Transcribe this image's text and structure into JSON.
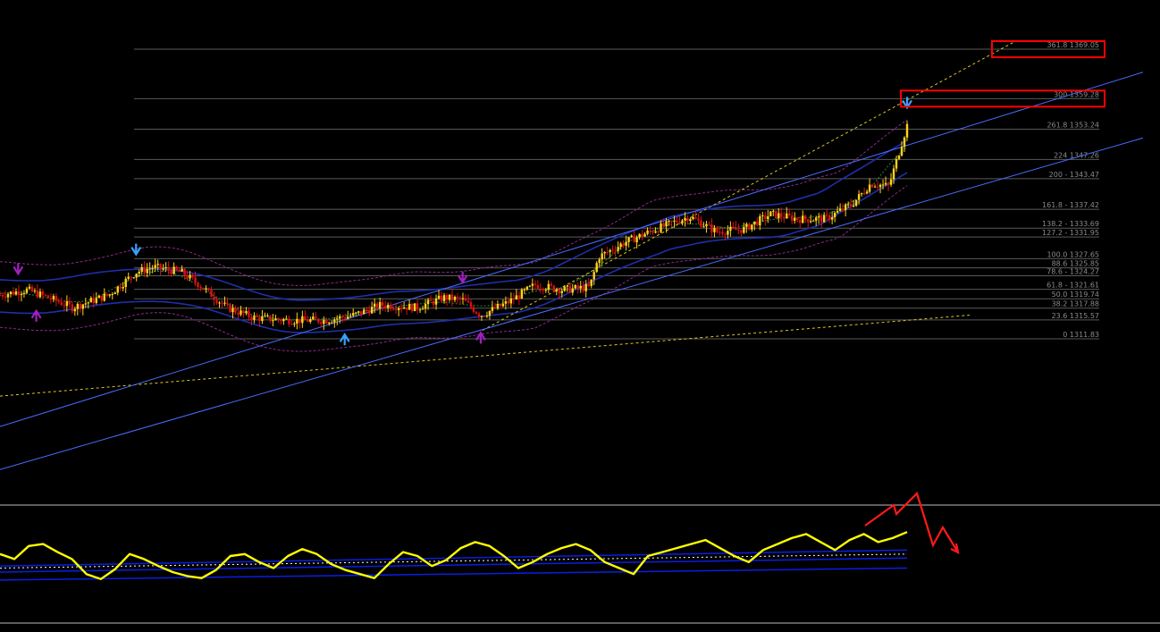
{
  "colors": {
    "background": "#000000",
    "fib_line": "#5a5a5a",
    "fib_text": "#8a8a8a",
    "channel_line": "#4a6cff",
    "candle_up": "#ffd21a",
    "candle_down": "#e01010",
    "band_outer": "#8a2a8a",
    "band_mid": "#1e2fa8",
    "band_dash": "#2e8a2e",
    "ma_dash": "#d8c820",
    "oscillator": "#ffff00",
    "osc_band": "#0a1ee0",
    "highlight_box": "#ff0000",
    "arrow_blue": "#3aa0ff",
    "arrow_purple": "#a020c0",
    "projection": "#ff1a1a"
  },
  "chart_data": {
    "type": "candlestick",
    "title": "",
    "xlabel": "",
    "ylabel": "",
    "ylim": [
      1290.0,
      1372.0
    ],
    "grid": false,
    "fibonacci_levels": [
      {
        "ratio": "361.8",
        "price": "1369.05",
        "highlighted": true
      },
      {
        "ratio": "300",
        "price": "1359.28",
        "highlighted": true
      },
      {
        "ratio": "261.8",
        "price": "1353.24",
        "highlighted": false
      },
      {
        "ratio": "224",
        "price": "1347.26",
        "highlighted": false
      },
      {
        "ratio": "200 -",
        "price": "1343.47",
        "highlighted": false
      },
      {
        "ratio": "161.8 -",
        "price": "1337.42",
        "highlighted": false
      },
      {
        "ratio": "138.2 -",
        "price": "1333.69",
        "highlighted": false
      },
      {
        "ratio": "127.2 -",
        "price": "1331.95",
        "highlighted": false
      },
      {
        "ratio": "100.0",
        "price": "1327.65",
        "highlighted": false
      },
      {
        "ratio": "88.6",
        "price": "1325.85",
        "highlighted": false
      },
      {
        "ratio": "78.6 -",
        "price": "1324.27",
        "highlighted": false
      },
      {
        "ratio": "61.8 -",
        "price": "1321.61",
        "highlighted": false
      },
      {
        "ratio": "50.0",
        "price": "1319.74",
        "highlighted": false
      },
      {
        "ratio": "38.2",
        "price": "1317.88",
        "highlighted": false
      },
      {
        "ratio": "23.6",
        "price": "1315.57",
        "highlighted": false
      },
      {
        "ratio": "0",
        "price": "1311.83",
        "highlighted": false
      }
    ],
    "price_path": [
      [
        0,
        1320.5
      ],
      [
        0.03,
        1321.5
      ],
      [
        0.06,
        1319.5
      ],
      [
        0.08,
        1318.0
      ],
      [
        0.12,
        1320.5
      ],
      [
        0.15,
        1325.0
      ],
      [
        0.17,
        1326.0
      ],
      [
        0.2,
        1325.0
      ],
      [
        0.22,
        1322.5
      ],
      [
        0.25,
        1318.0
      ],
      [
        0.28,
        1316.0
      ],
      [
        0.32,
        1315.5
      ],
      [
        0.36,
        1315.5
      ],
      [
        0.39,
        1316.5
      ],
      [
        0.42,
        1318.5
      ],
      [
        0.46,
        1318.0
      ],
      [
        0.49,
        1320.0
      ],
      [
        0.51,
        1319.5
      ],
      [
        0.53,
        1316.5
      ],
      [
        0.56,
        1319.0
      ],
      [
        0.59,
        1322.5
      ],
      [
        0.62,
        1321.5
      ],
      [
        0.65,
        1322.0
      ],
      [
        0.66,
        1328.0
      ],
      [
        0.69,
        1331.0
      ],
      [
        0.73,
        1334.0
      ],
      [
        0.76,
        1336.0
      ],
      [
        0.79,
        1333.0
      ],
      [
        0.82,
        1333.5
      ],
      [
        0.85,
        1336.5
      ],
      [
        0.88,
        1335.5
      ],
      [
        0.91,
        1335.5
      ],
      [
        0.94,
        1338.5
      ],
      [
        0.96,
        1342.5
      ],
      [
        0.98,
        1342.0
      ],
      [
        0.99,
        1348.0
      ],
      [
        1.0,
        1354.0
      ]
    ],
    "channel_lines": [
      {
        "name": "",
        "x": [
          0,
          1.26
        ],
        "y": [
          1294.5,
          1364.5
        ]
      },
      {
        "name": "",
        "x": [
          0,
          1.26
        ],
        "y": [
          1286.0,
          1351.5
        ]
      }
    ],
    "oscillator": {
      "type": "line",
      "ylim": [
        0,
        100
      ],
      "values": [
        60,
        55,
        68,
        70,
        62,
        55,
        40,
        35,
        45,
        60,
        55,
        48,
        42,
        38,
        36,
        44,
        58,
        60,
        52,
        46,
        58,
        65,
        60,
        50,
        44,
        40,
        36,
        50,
        62,
        58,
        48,
        54,
        66,
        72,
        68,
        58,
        46,
        52,
        60,
        66,
        70,
        64,
        52,
        46,
        40,
        58,
        62,
        66,
        70,
        74,
        66,
        58,
        52,
        64,
        70,
        76,
        80,
        72,
        64,
        74,
        80,
        72,
        76,
        82
      ],
      "bands": {
        "upper": 58,
        "mid": 48,
        "lower": 38
      }
    },
    "markers": [
      {
        "type": "down-arrow",
        "color": "purple",
        "index": 0.02
      },
      {
        "type": "up-arrow",
        "color": "purple",
        "index": 0.04
      },
      {
        "type": "down-arrow",
        "color": "blue",
        "index": 0.15
      },
      {
        "type": "up-arrow",
        "color": "blue",
        "index": 0.38
      },
      {
        "type": "down-arrow",
        "color": "purple",
        "index": 0.51
      },
      {
        "type": "up-arrow",
        "color": "purple",
        "index": 0.53
      },
      {
        "type": "down-arrow",
        "color": "blue",
        "index": 1.0
      }
    ]
  }
}
